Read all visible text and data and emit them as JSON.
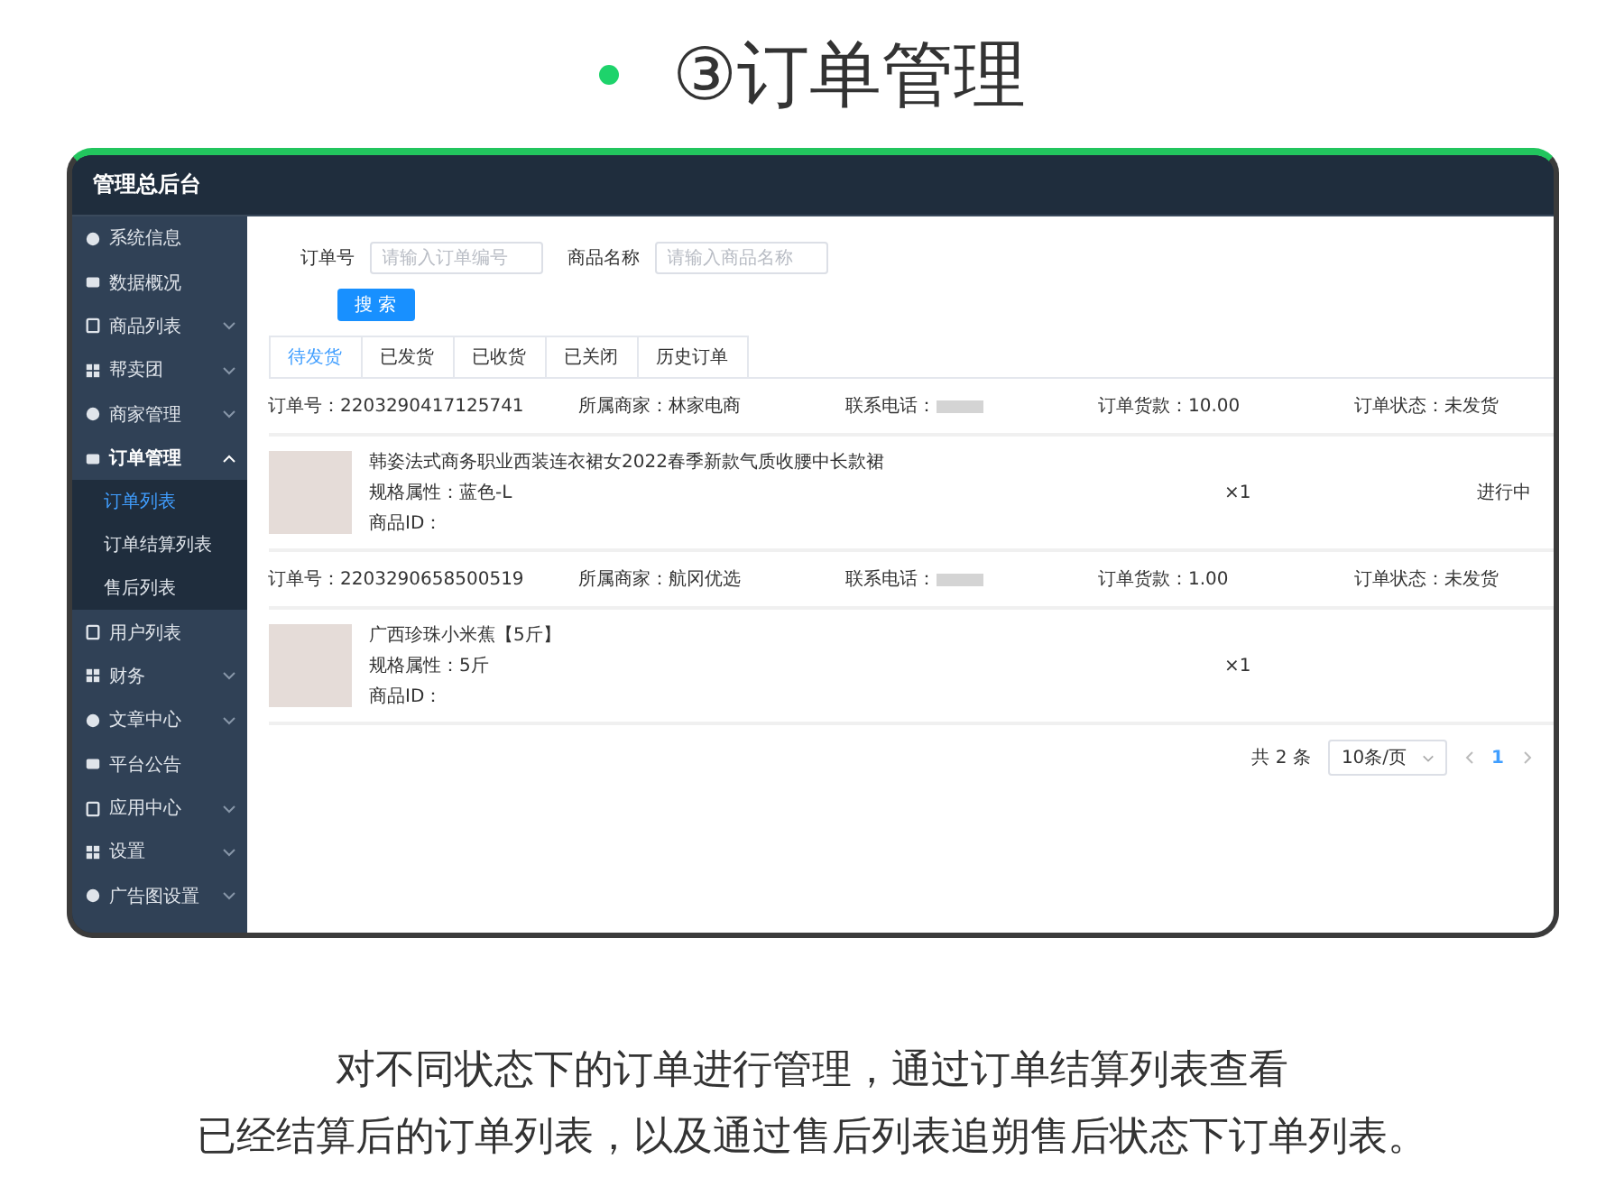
{
  "headline": {
    "title": "③订单管理"
  },
  "app": {
    "title": "管理总后台"
  },
  "sidebar": {
    "items": [
      {
        "label": "系统信息"
      },
      {
        "label": "数据概况"
      },
      {
        "label": "商品列表",
        "expanded": false
      },
      {
        "label": "帮卖团",
        "expanded": false
      },
      {
        "label": "商家管理",
        "expanded": false
      },
      {
        "label": "订单管理",
        "expanded": true,
        "children": [
          {
            "label": "订单列表",
            "selected": true
          },
          {
            "label": "订单结算列表",
            "selected": false
          },
          {
            "label": "售后列表",
            "selected": false
          }
        ]
      },
      {
        "label": "用户列表"
      },
      {
        "label": "财务",
        "expanded": false
      },
      {
        "label": "文章中心",
        "expanded": false
      },
      {
        "label": "平台公告"
      },
      {
        "label": "应用中心",
        "expanded": false
      },
      {
        "label": "设置",
        "expanded": false
      },
      {
        "label": "广告图设置",
        "expanded": false
      }
    ]
  },
  "search": {
    "fields": [
      {
        "label": "订单号",
        "placeholder": "请输入订单编号"
      },
      {
        "label": "商品名称",
        "placeholder": "请输入商品名称"
      }
    ],
    "button": "搜 索"
  },
  "tabs": [
    {
      "label": "待发货",
      "selected": true
    },
    {
      "label": "已发货",
      "selected": false
    },
    {
      "label": "已收货",
      "selected": false
    },
    {
      "label": "已关闭",
      "selected": false
    },
    {
      "label": "历史订单",
      "selected": false
    }
  ],
  "orders": [
    {
      "order_no": "订单号：2203290417125741",
      "store": "所属商家：林家电商",
      "phone_label": "联系电话：",
      "amount": "订单货款：10.00",
      "status": "订单状态：未发货",
      "product": {
        "name": "韩姿法式商务职业西装连衣裙女2022春季新款气质收腰中长款裙",
        "spec": "规格属性：蓝色-L",
        "product_id": "商品ID：",
        "quantity": "×1",
        "progress": "进行中"
      }
    },
    {
      "order_no": "订单号：2203290658500519",
      "store": "所属商家：航冈优选",
      "phone_label": "联系电话：",
      "amount": "订单货款：1.00",
      "status": "订单状态：未发货",
      "product": {
        "name": "广西珍珠小米蕉【5斤】",
        "spec": "规格属性：5斤",
        "product_id": "商品ID：",
        "quantity": "×1"
      }
    }
  ],
  "pagination": {
    "total": "共 2 条",
    "page_size": "10条/页",
    "pages": [
      {
        "label": "1",
        "selected": true
      }
    ]
  },
  "caption": [
    "对不同状态下的订单进行管理，通过订单结算列表查看",
    "已经结算后的订单列表，以及通过售后列表追朔售后状态下订单列表。"
  ]
}
